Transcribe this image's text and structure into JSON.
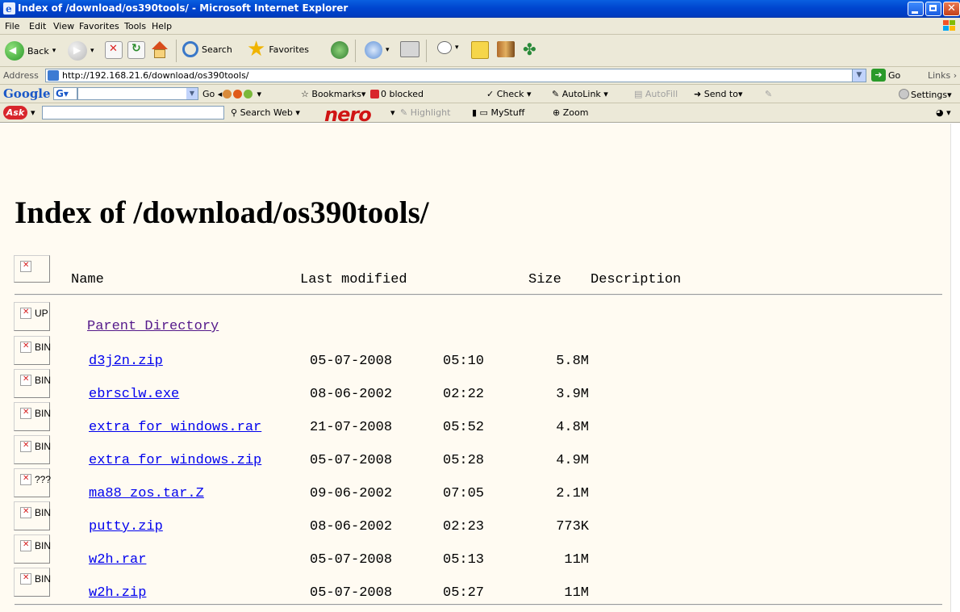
{
  "window": {
    "title": "Index of /download/os390tools/ - Microsoft Internet Explorer"
  },
  "menu": [
    "File",
    "Edit",
    "View",
    "Favorites",
    "Tools",
    "Help"
  ],
  "toolbar": {
    "back": "Back",
    "search": "Search",
    "favorites": "Favorites"
  },
  "address": {
    "label": "Address",
    "url": "http://192.168.21.6/download/os390tools/",
    "go": "Go",
    "links": "Links"
  },
  "google_bar": {
    "logo": "Google",
    "g_button": "G",
    "go": "Go",
    "bookmarks": "Bookmarks",
    "blocked": "0 blocked",
    "check": "Check",
    "autolink": "AutoLink",
    "autofill": "AutoFill",
    "sendto": "Send to",
    "settings": "Settings"
  },
  "ask_bar": {
    "logo": "Ask",
    "search_web": "Search Web",
    "nero": "nero",
    "highlight": "Highlight",
    "mystuff": "MyStuff",
    "zoom": "Zoom"
  },
  "page": {
    "heading": "Index of /download/os390tools/",
    "columns": {
      "name": "Name",
      "modified": "Last modified",
      "size": "Size",
      "description": "Description"
    },
    "parent": {
      "alt": "UP",
      "label": "Parent Directory"
    },
    "files": [
      {
        "alt": "BIN",
        "name": "d3j2n.zip",
        "date": "05-07-2008",
        "time": "05:10",
        "size": "5.8M"
      },
      {
        "alt": "BIN",
        "name": "ebrsclw.exe",
        "date": "08-06-2002",
        "time": "02:22",
        "size": "3.9M"
      },
      {
        "alt": "BIN",
        "name": "extra_for_windows.rar",
        "date": "21-07-2008",
        "time": "05:52",
        "size": "4.8M"
      },
      {
        "alt": "BIN",
        "name": "extra_for_windows.zip",
        "date": "05-07-2008",
        "time": "05:28",
        "size": "4.9M"
      },
      {
        "alt": "???",
        "name": "ma88_zos.tar.Z",
        "date": "09-06-2002",
        "time": "07:05",
        "size": "2.1M"
      },
      {
        "alt": "BIN",
        "name": "putty.zip",
        "date": "08-06-2002",
        "time": "02:23",
        "size": "773K"
      },
      {
        "alt": "BIN",
        "name": "w2h.rar",
        "date": "05-07-2008",
        "time": "05:13",
        "size": "11M"
      },
      {
        "alt": "BIN",
        "name": "w2h.zip",
        "date": "05-07-2008",
        "time": "05:27",
        "size": "11M"
      }
    ]
  }
}
